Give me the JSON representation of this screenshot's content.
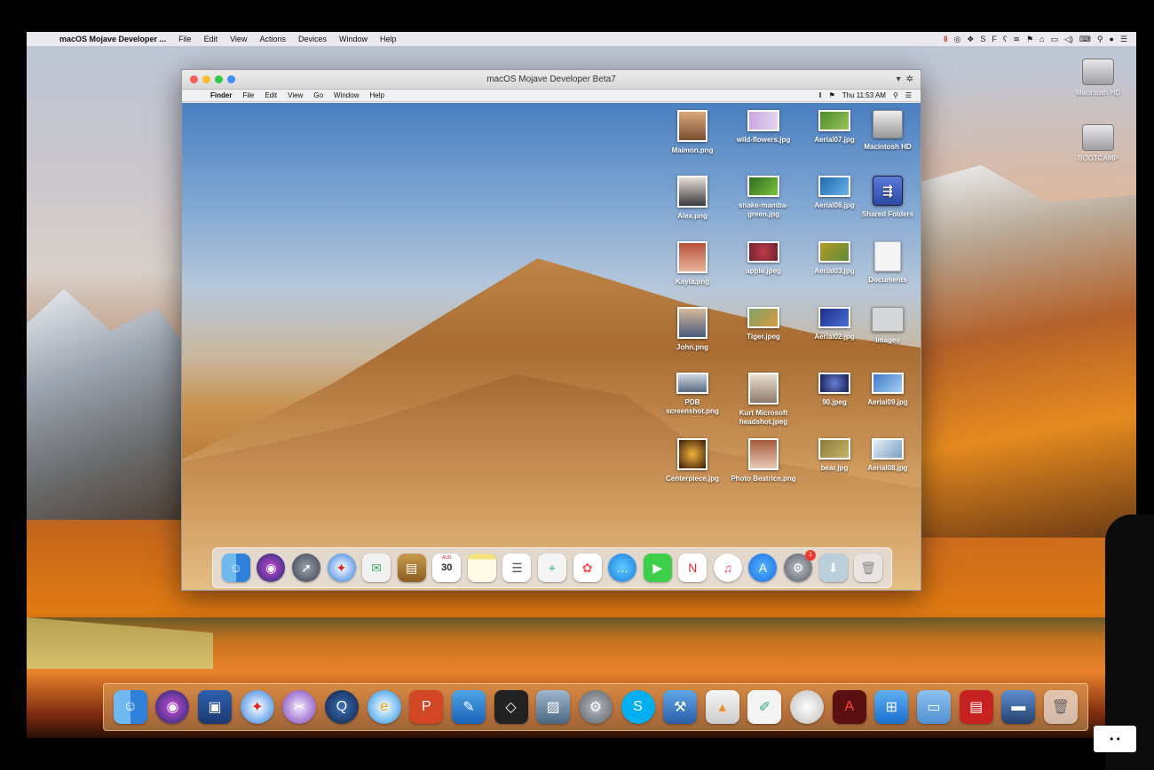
{
  "outer_menubar": {
    "app_name": "macOS Mojave Developer ...",
    "items": [
      "File",
      "Edit",
      "View",
      "Actions",
      "Devices",
      "Window",
      "Help"
    ],
    "status_icons": [
      "parallels-icon",
      "opera-icon",
      "dropbox-icon",
      "skype-icon",
      "flipboard-icon",
      "bear-icon",
      "wifi-icon",
      "flag-icon",
      "home-icon",
      "airplay-icon",
      "volume-icon",
      "keyboard-icon",
      "search-icon",
      "siri-icon",
      "menu-icon"
    ]
  },
  "outer_desktop": {
    "icons": [
      {
        "label": "Macintosh HD"
      },
      {
        "label": "BOOTCAMP"
      }
    ]
  },
  "vm_window": {
    "title": "macOS Mojave Developer Beta7",
    "inner_menubar": {
      "app_name": "Finder",
      "items": [
        "File",
        "Edit",
        "View",
        "Go",
        "Window",
        "Help"
      ],
      "clock": "Thu 11:53 AM"
    },
    "desktop_files": [
      {
        "label": "Maimon.png"
      },
      {
        "label": "wild-flowers.jpg"
      },
      {
        "label": "Aerial07.jpg"
      },
      {
        "label": "Macintosh HD"
      },
      {
        "label": "Alex.png"
      },
      {
        "label": "snake-mamba-green.jpg"
      },
      {
        "label": "Aerial06.jpg"
      },
      {
        "label": "Shared Folders"
      },
      {
        "label": "Kayla.png"
      },
      {
        "label": "apple.jpeg"
      },
      {
        "label": "Aerial03.jpg"
      },
      {
        "label": "Documents"
      },
      {
        "label": "John.png"
      },
      {
        "label": "Tiger.jpeg"
      },
      {
        "label": "Aerial02.jpg"
      },
      {
        "label": "Images"
      },
      {
        "label": "PDB screenshot.png"
      },
      {
        "label": "Kurt Microsoft headshot.jpeg"
      },
      {
        "label": "90.jpeg"
      },
      {
        "label": "Aerial09.jpg"
      },
      {
        "label": "Centerpiece.jpg"
      },
      {
        "label": "Photo Beatrice.png"
      },
      {
        "label": "bear.jpg"
      },
      {
        "label": "Aerial08.jpg"
      }
    ],
    "dock": {
      "calendar_month": "AUG",
      "calendar_day": "30",
      "system_prefs_badge": "1"
    }
  },
  "colors": {
    "accent_blue": "#3d8ef5",
    "badge_red": "#f03a2f"
  },
  "corner_badge": "• •"
}
